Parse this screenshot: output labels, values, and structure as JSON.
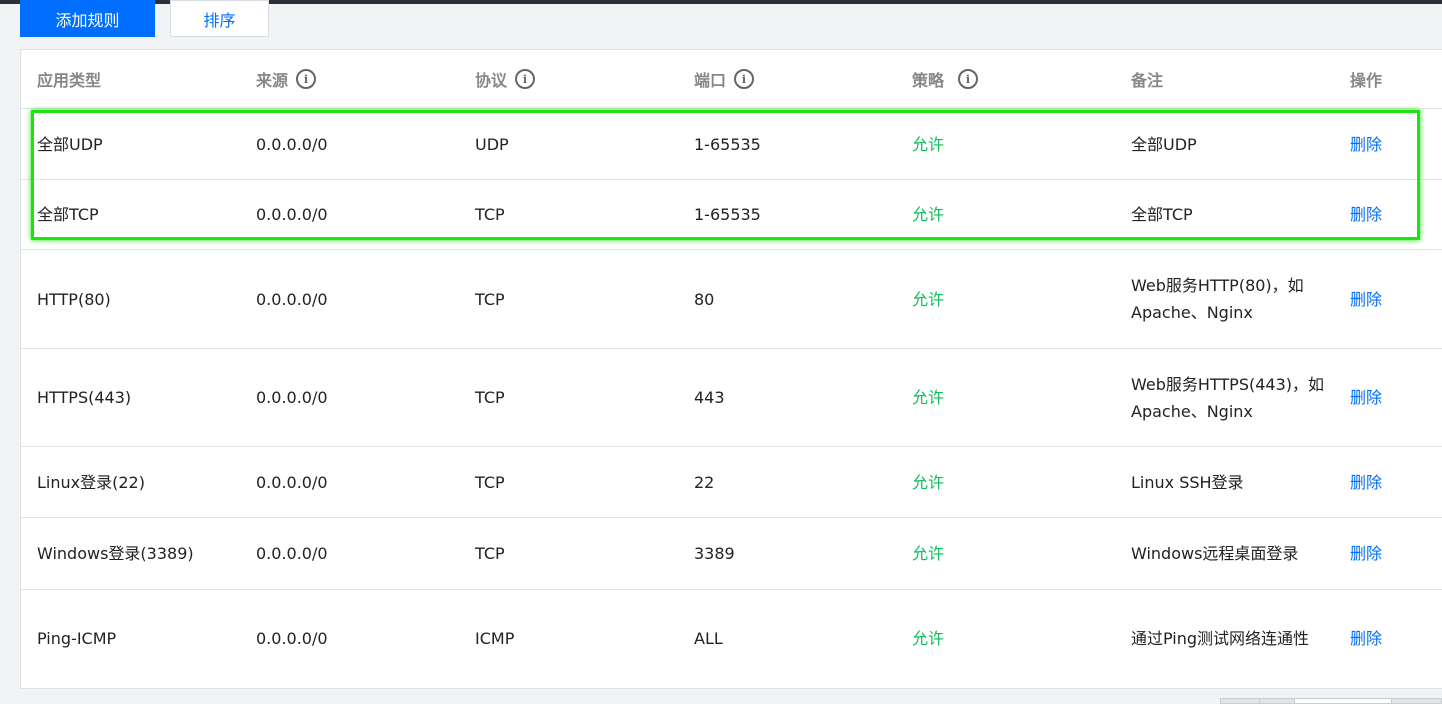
{
  "toolbar": {
    "add_label": "添加规则",
    "sort_label": "排序"
  },
  "table": {
    "headers": [
      {
        "label": "应用类型",
        "info": false
      },
      {
        "label": "来源",
        "info": true
      },
      {
        "label": "协议",
        "info": true
      },
      {
        "label": "端口",
        "info": true
      },
      {
        "label": "策略",
        "info": true
      },
      {
        "label": "备注",
        "info": false
      },
      {
        "label": "操作",
        "info": false
      }
    ],
    "rows": [
      {
        "type": "全部UDP",
        "source": "0.0.0.0/0",
        "protocol": "UDP",
        "port": "1-65535",
        "policy": "允许",
        "note": "全部UDP",
        "action": "删除"
      },
      {
        "type": "全部TCP",
        "source": "0.0.0.0/0",
        "protocol": "TCP",
        "port": "1-65535",
        "policy": "允许",
        "note": "全部TCP",
        "action": "删除"
      },
      {
        "type": "HTTP(80)",
        "source": "0.0.0.0/0",
        "protocol": "TCP",
        "port": "80",
        "policy": "允许",
        "note": "Web服务HTTP(80)，如Apache、Nginx",
        "action": "删除"
      },
      {
        "type": "HTTPS(443)",
        "source": "0.0.0.0/0",
        "protocol": "TCP",
        "port": "443",
        "policy": "允许",
        "note": "Web服务HTTPS(443)，如 Apache、Nginx",
        "action": "删除"
      },
      {
        "type": "Linux登录(22)",
        "source": "0.0.0.0/0",
        "protocol": "TCP",
        "port": "22",
        "policy": "允许",
        "note": "Linux SSH登录",
        "action": "删除"
      },
      {
        "type": "Windows登录(3389)",
        "source": "0.0.0.0/0",
        "protocol": "TCP",
        "port": "3389",
        "policy": "允许",
        "note": "Windows远程桌面登录",
        "action": "删除"
      },
      {
        "type": "Ping-ICMP",
        "source": "0.0.0.0/0",
        "protocol": "ICMP",
        "port": "ALL",
        "policy": "允许",
        "note": "通过Ping测试网络连通性",
        "action": "删除"
      }
    ]
  },
  "colors": {
    "primary": "#006eff",
    "allow": "#0abf5b",
    "highlight": "#1de312"
  },
  "icons": {
    "info": "info-circle-icon"
  }
}
